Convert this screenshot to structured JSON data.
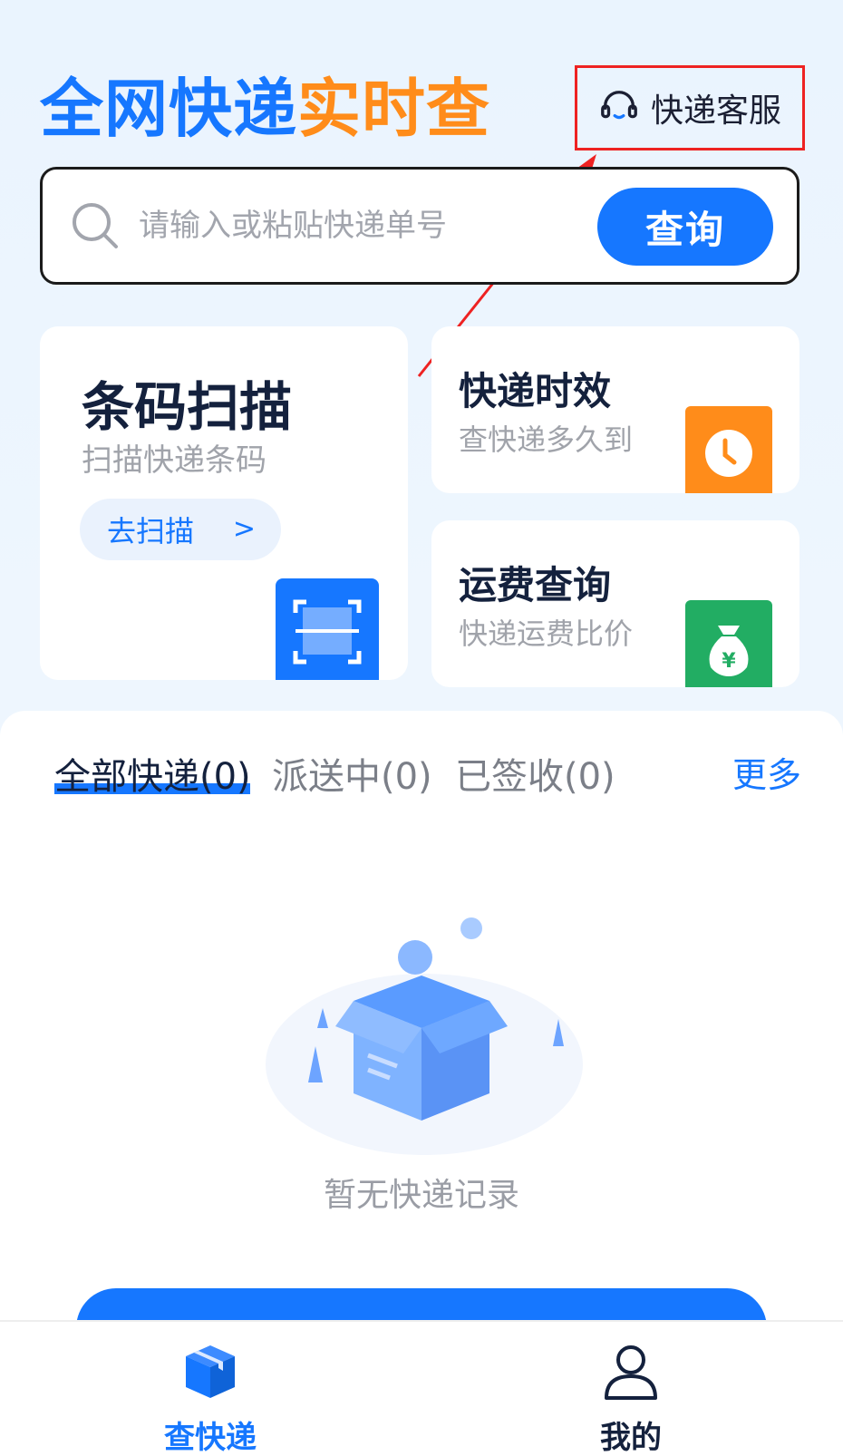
{
  "header": {
    "title_part1": "全网快递",
    "title_part2": "实时查",
    "service_label": "快递客服",
    "service_icon": "headset-icon"
  },
  "search": {
    "placeholder": "请输入或粘贴快递单号",
    "value": "",
    "button_label": "查询"
  },
  "cards": {
    "scan": {
      "title": "条码扫描",
      "subtitle": "扫描快递条码",
      "action_label": "去扫描",
      "action_chevron": ">"
    },
    "time": {
      "title": "快递时效",
      "subtitle": "查快递多久到"
    },
    "fee": {
      "title": "运费查询",
      "subtitle": "快递运费比价"
    }
  },
  "tabs": [
    {
      "label": "全部快递(0)",
      "active": true
    },
    {
      "label": "派送中(0)",
      "active": false
    },
    {
      "label": "已签收(0)",
      "active": false
    }
  ],
  "more_label": "更多",
  "empty_text": "暂无快递记录",
  "bottom_nav": [
    {
      "label": "查快递",
      "icon": "package-icon",
      "active": true
    },
    {
      "label": "我的",
      "icon": "user-icon",
      "active": false
    }
  ],
  "colors": {
    "primary": "#1677ff",
    "accent_orange": "#ff8c1a",
    "accent_green": "#22ad63",
    "highlight_red": "#ee2222"
  }
}
